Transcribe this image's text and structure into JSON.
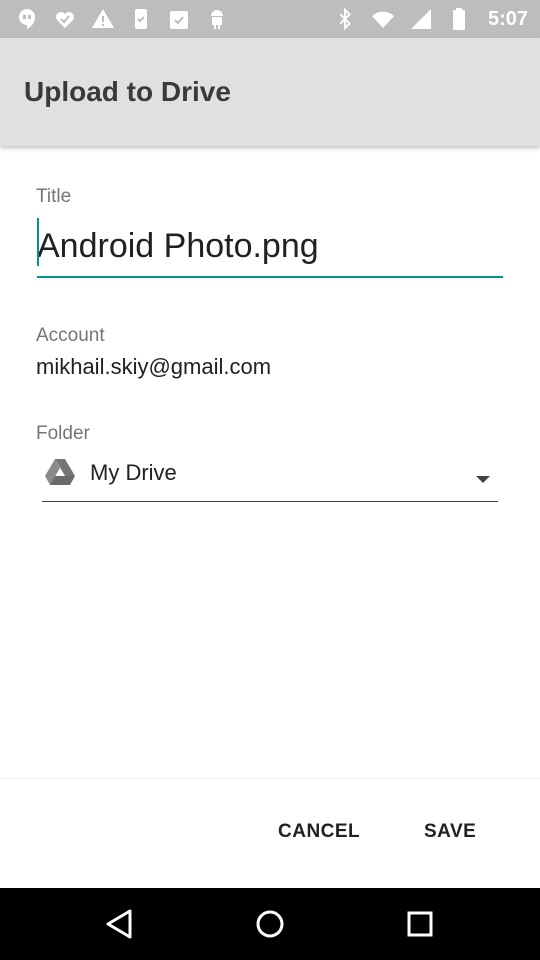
{
  "status_bar": {
    "time": "5:07",
    "icons_left": [
      "hangouts-icon",
      "checkmark-heart-icon",
      "warning-icon",
      "phone-check-icon",
      "clipboard-check-icon",
      "android-icon"
    ],
    "icons_right": [
      "bluetooth-icon",
      "wifi-icon",
      "cellular-icon",
      "battery-icon"
    ]
  },
  "toolbar": {
    "title": "Upload to Drive"
  },
  "form": {
    "title_label": "Title",
    "title_value": "Android Photo.png",
    "account_label": "Account",
    "account_value": "mikhail.skiy@gmail.com",
    "folder_label": "Folder",
    "folder_value": "My Drive",
    "folder_icon": "google-drive-icon"
  },
  "buttons": {
    "cancel": "CANCEL",
    "save": "SAVE"
  },
  "nav": {
    "back": "back-icon",
    "home": "home-icon",
    "recents": "recents-icon"
  },
  "colors": {
    "accent": "#009688",
    "toolbar_bg": "#e0e0e0",
    "status_bar_bg": "#bdbdbd"
  }
}
